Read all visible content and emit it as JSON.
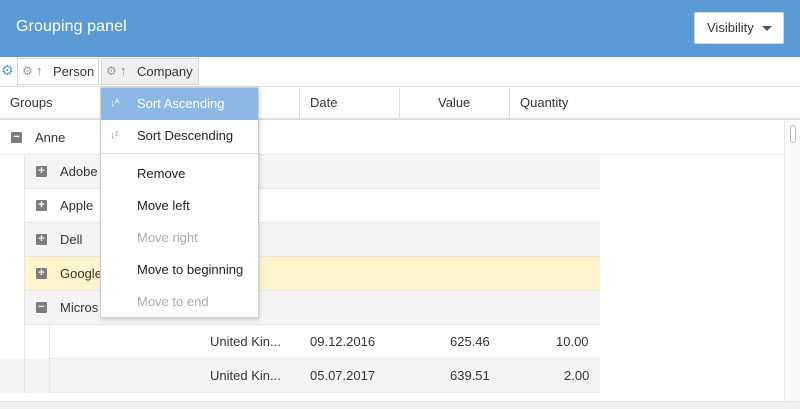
{
  "header": {
    "title": "Grouping panel",
    "visibility_label": "Visibility"
  },
  "group_bar": {
    "chips": [
      {
        "label": "Person",
        "sort": "ascending"
      },
      {
        "label": "Company",
        "sort": "ascending"
      }
    ]
  },
  "columns": [
    "Groups",
    "Date",
    "Value",
    "Quantity"
  ],
  "groups": [
    {
      "label": "Anne",
      "state": "collapse"
    },
    {
      "label": "Adobe",
      "state": "expand"
    },
    {
      "label": "Apple",
      "state": "expand"
    },
    {
      "label": "Dell",
      "state": "expand"
    },
    {
      "label": "Google",
      "state": "expand",
      "highlighted": true
    },
    {
      "label": "Micros",
      "state": "collapse"
    }
  ],
  "rows": [
    {
      "country": "United Kin...",
      "date": "09.12.2016",
      "value": "625.46",
      "quantity": "10.00"
    },
    {
      "country": "United Kin...",
      "date": "05.07.2017",
      "value": "639.51",
      "quantity": "2.00"
    }
  ],
  "context_menu": {
    "items": [
      {
        "label": "Sort Ascending",
        "icon": "sort-az-icon",
        "active": true
      },
      {
        "label": "Sort Descending",
        "icon": "sort-za-icon"
      },
      {
        "label": "Remove"
      },
      {
        "label": "Move left"
      },
      {
        "label": "Move right",
        "disabled": true
      },
      {
        "label": "Move to beginning"
      },
      {
        "label": "Move to end",
        "disabled": true
      }
    ]
  },
  "colors": {
    "header": "#5b9bd5",
    "highlight": "#fff4cc",
    "menu_active": "#8bb8e4"
  }
}
